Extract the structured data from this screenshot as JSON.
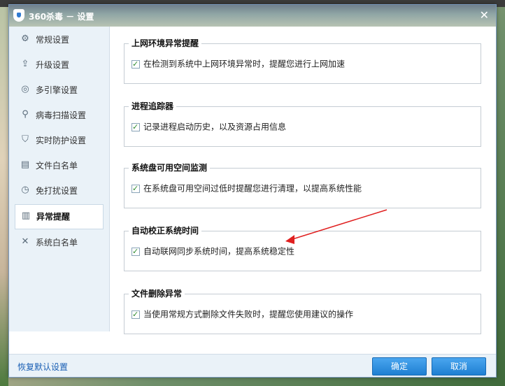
{
  "window": {
    "title": "360杀毒 － 设置",
    "close_glyph": "✕"
  },
  "sidebar": {
    "items": [
      {
        "label": "常规设置",
        "icon": "gear-icon"
      },
      {
        "label": "升级设置",
        "icon": "upload-icon"
      },
      {
        "label": "多引擎设置",
        "icon": "engine-icon"
      },
      {
        "label": "病毒扫描设置",
        "icon": "search-icon"
      },
      {
        "label": "实时防护设置",
        "icon": "shield-icon"
      },
      {
        "label": "文件白名单",
        "icon": "document-icon"
      },
      {
        "label": "免打扰设置",
        "icon": "clock-icon"
      },
      {
        "label": "异常提醒",
        "icon": "chart-icon",
        "active": true
      },
      {
        "label": "系统白名单",
        "icon": "tools-icon"
      }
    ]
  },
  "groups": [
    {
      "title": "上网环境异常提醒",
      "option": "在检测到系统中上网环境异常时，提醒您进行上网加速",
      "checked": true
    },
    {
      "title": "进程追踪器",
      "option": "记录进程启动历史，以及资源占用信息",
      "checked": true
    },
    {
      "title": "系统盘可用空间监测",
      "option": "在系统盘可用空间过低时提醒您进行清理，以提高系统性能",
      "checked": true
    },
    {
      "title": "自动校正系统时间",
      "option": "自动联网同步系统时间，提高系统稳定性",
      "checked": true
    },
    {
      "title": "文件删除异常",
      "option": "当使用常规方式删除文件失败时，提醒您使用建议的操作",
      "checked": true
    }
  ],
  "bottom": {
    "restore_label": "恢复默认设置",
    "ok_label": "确定",
    "cancel_label": "取消"
  },
  "colors": {
    "accent": "#1e7fd2",
    "sidebar_bg": "#eaf2f8",
    "arrow": "#e02020"
  }
}
